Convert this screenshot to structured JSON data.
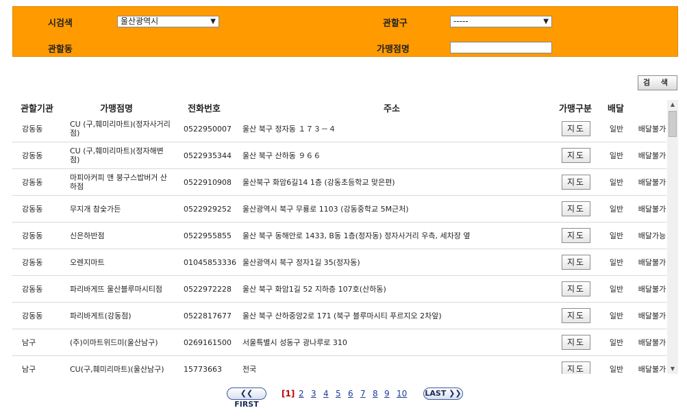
{
  "search": {
    "city_label": "시검색",
    "city_value": "울산광역시",
    "district_label": "관할구",
    "district_value": "-----",
    "dong_label": "관할동",
    "store_label": "가맹점명",
    "store_value": "",
    "search_button": "검 색"
  },
  "table": {
    "headers": [
      "관할기관",
      "가맹점명",
      "전화번호",
      "주소",
      "가맹구분",
      "배달"
    ],
    "map_button_label": "지도",
    "rows": [
      {
        "agency": "강동동",
        "name": "CU (구,훼미리마트)(정자사거리점)",
        "phone": "0522950007",
        "address": "울산 북구 정자동 １７３－４",
        "type": "일반",
        "delivery": "배달불가"
      },
      {
        "agency": "강동동",
        "name": "CU (구,훼미리마트)(정자해변점)",
        "phone": "0522935344",
        "address": "울산 북구 산하동 ９６６",
        "type": "일반",
        "delivery": "배달불가"
      },
      {
        "agency": "강동동",
        "name": "마피아커피 앤 붕구스밥버거 산하점",
        "phone": "0522910908",
        "address": "울산북구 화암6길14 1층 (강동초등학교 맞은편)",
        "type": "일반",
        "delivery": "배달불가"
      },
      {
        "agency": "강동동",
        "name": "무지개 참숯가든",
        "phone": "0522929252",
        "address": "울산광역시 북구 무룡로 1103 (강동중학교 5M근처)",
        "type": "일반",
        "delivery": "배달불가"
      },
      {
        "agency": "강동동",
        "name": "신은하반점",
        "phone": "0522955855",
        "address": "울산 북구 동해안로 1433, B동 1층(정자동) 정자사거리 우측, 세차장 옆",
        "type": "일반",
        "delivery": "배달가능"
      },
      {
        "agency": "강동동",
        "name": "오렌지마트",
        "phone": "01045853336",
        "address": "울산광역시 북구 정자1길 35(정자동)",
        "type": "일반",
        "delivery": "배달불가"
      },
      {
        "agency": "강동동",
        "name": "파리바게뜨 울산블루마시티점",
        "phone": "0522972228",
        "address": "울산 북구 화암1길 52 지하층 107호(산하동)",
        "type": "일반",
        "delivery": "배달불가"
      },
      {
        "agency": "강동동",
        "name": "파리바게트(강동점)",
        "phone": "0522817677",
        "address": "울산 북구 산하중앙2로 171 (북구 블루마시티 푸르지오 2차앞)",
        "type": "일반",
        "delivery": "배달불가"
      },
      {
        "agency": "남구",
        "name": "(주)이마트위드미(울산남구)",
        "phone": "0269161500",
        "address": "서울특별시 성동구 광나루로 310",
        "type": "일반",
        "delivery": "배달불가"
      },
      {
        "agency": "남구",
        "name": "CU(구,훼미리마트)(울산남구)",
        "phone": "15773663",
        "address": "전국",
        "type": "일반",
        "delivery": "배달불가"
      }
    ]
  },
  "pagination": {
    "first_label": "❮❮ FIRST",
    "last_label": "LAST ❯❯",
    "current": "[1]",
    "pages": [
      "2",
      "3",
      "4",
      "5",
      "6",
      "7",
      "8",
      "9",
      "10"
    ]
  }
}
